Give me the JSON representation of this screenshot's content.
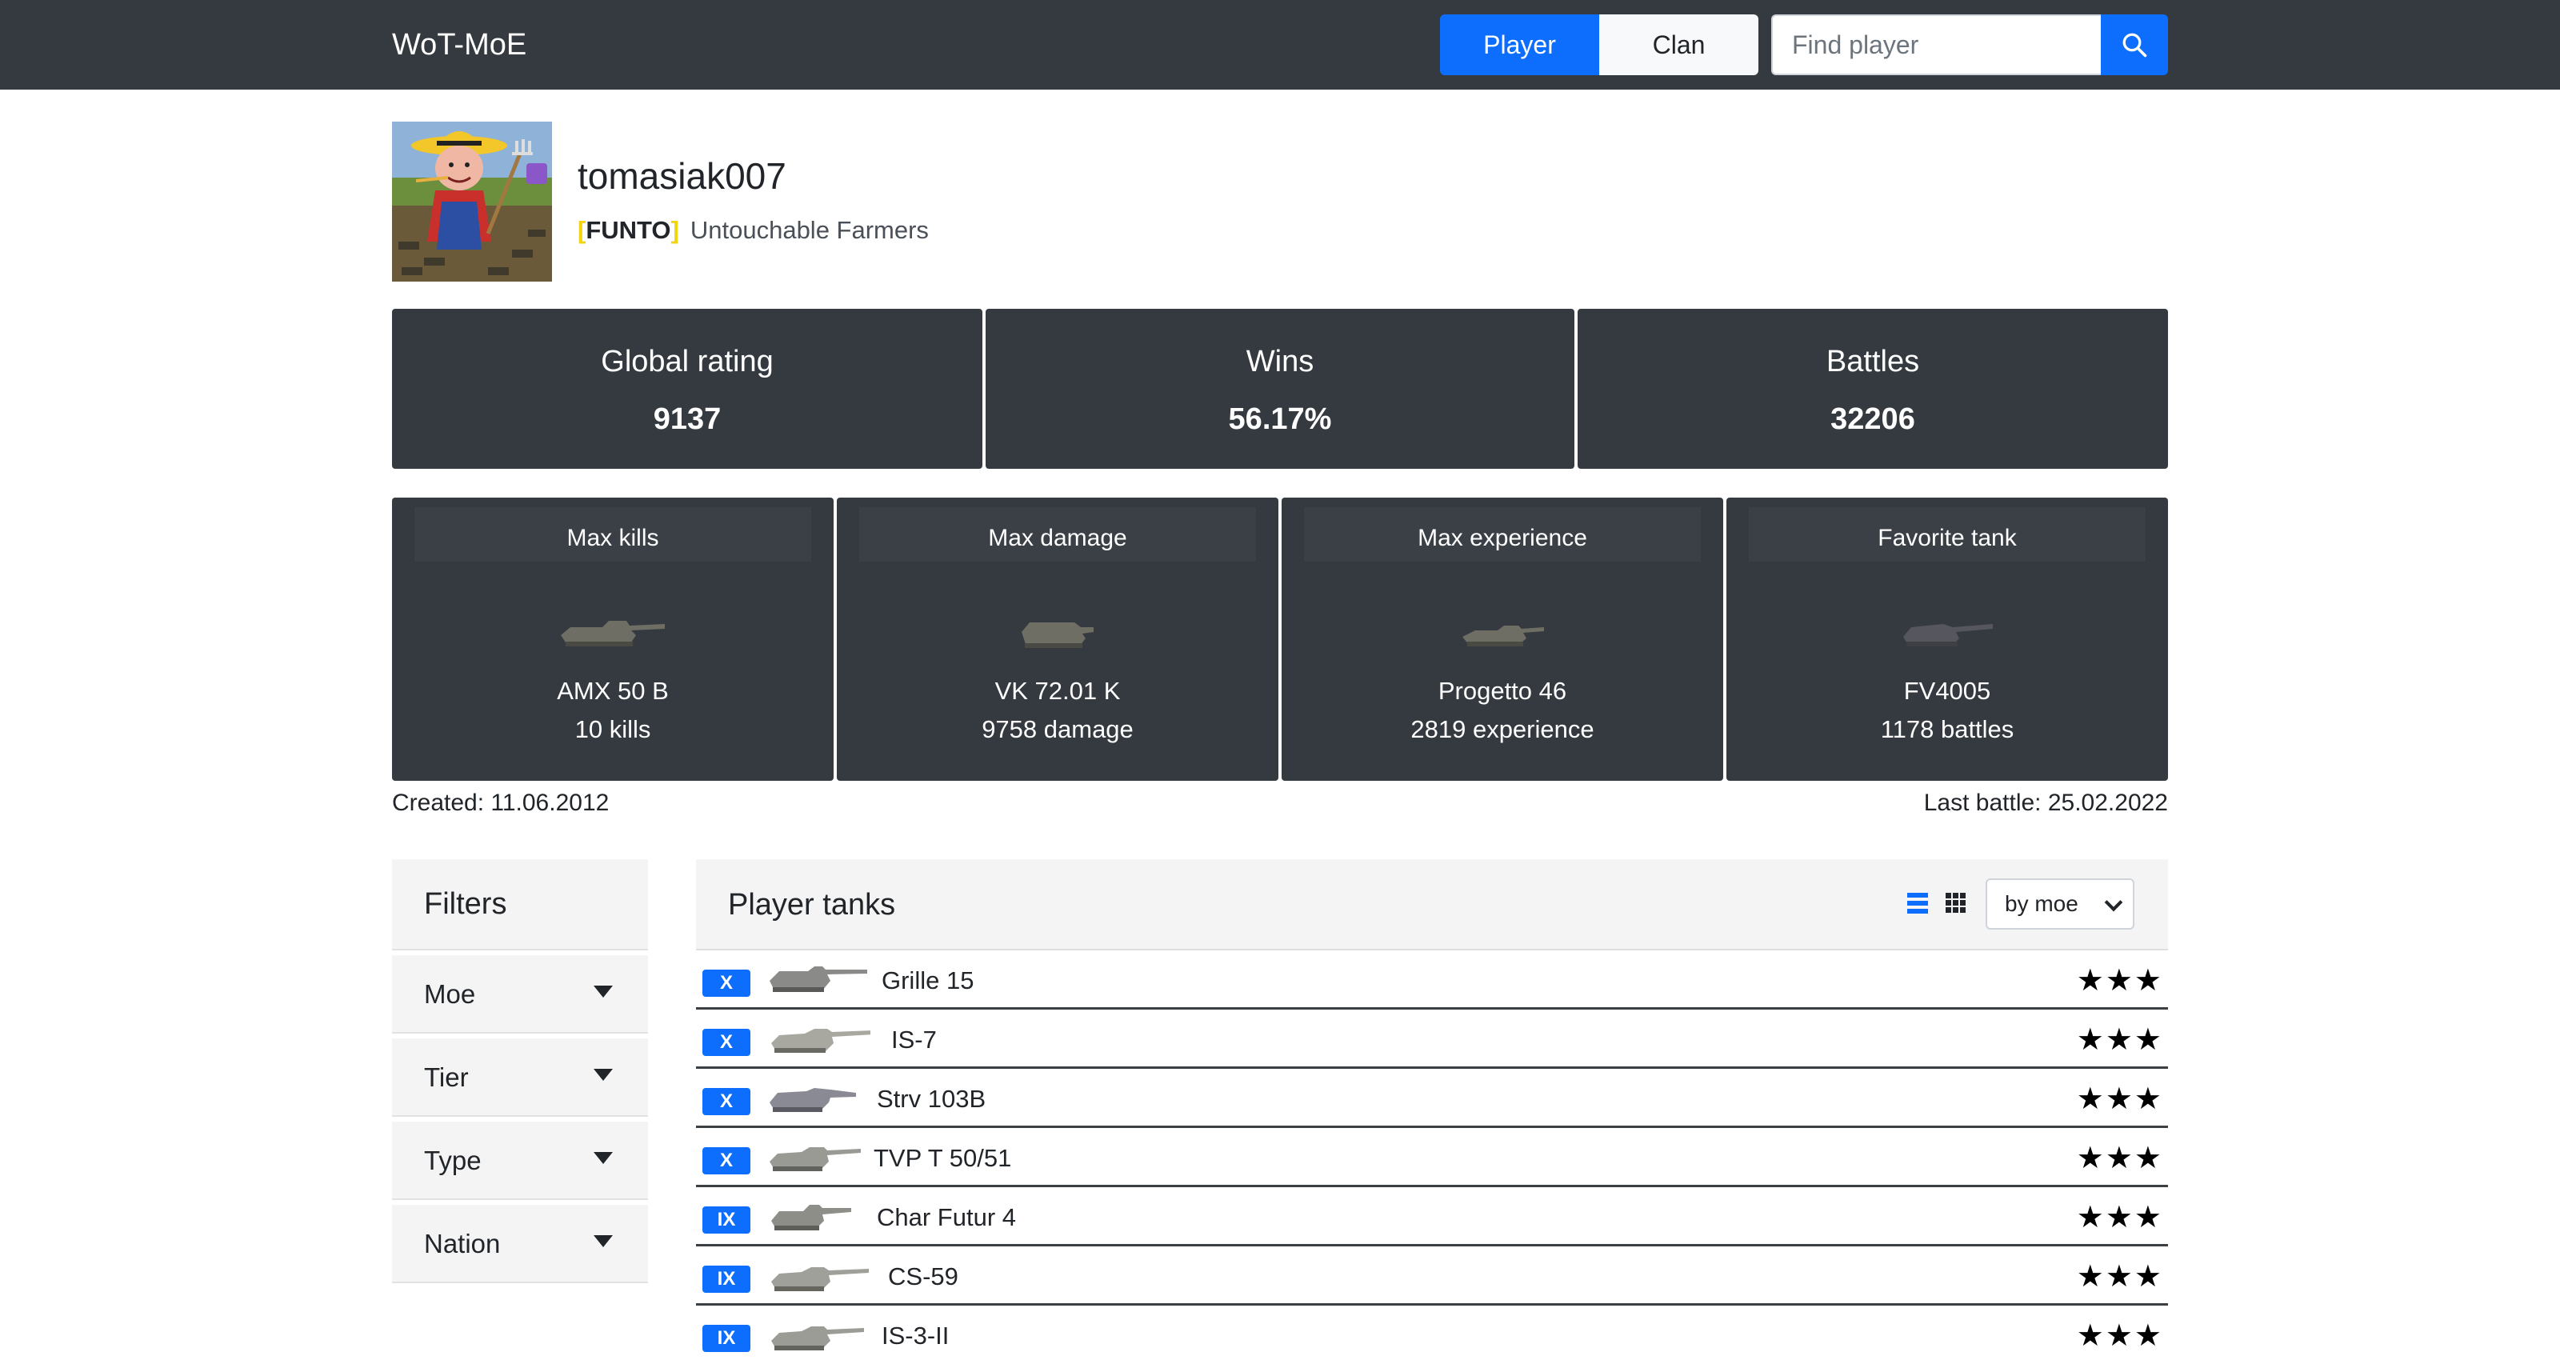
{
  "nav": {
    "brand": "WoT-MoE",
    "tab_player": "Player",
    "tab_clan": "Clan",
    "search_placeholder": "Find player",
    "search_icon": "search-icon"
  },
  "profile": {
    "username": "tomasiak007",
    "clan_tag": "FUNTO",
    "clan_name": "Untouchable Farmers"
  },
  "stats": [
    {
      "title": "Global rating",
      "value": "9137"
    },
    {
      "title": "Wins",
      "value": "56.17%"
    },
    {
      "title": "Battles",
      "value": "32206"
    }
  ],
  "records": [
    {
      "title": "Max kills",
      "tank": "AMX 50 B",
      "value": "10 kills"
    },
    {
      "title": "Max damage",
      "tank": "VK 72.01 K",
      "value": "9758 damage"
    },
    {
      "title": "Max experience",
      "tank": "Progetto 46",
      "value": "2819 experience"
    },
    {
      "title": "Favorite tank",
      "tank": "FV4005",
      "value": "1178 battles"
    }
  ],
  "dates": {
    "created": "Created: 11.06.2012",
    "last_battle": "Last battle: 25.02.2022"
  },
  "filters": {
    "title": "Filters",
    "items": [
      "Moe",
      "Tier",
      "Type",
      "Nation"
    ]
  },
  "tanks": {
    "title": "Player tanks",
    "sort_value": "by moe",
    "rows": [
      {
        "tier": "X",
        "name": "Grille 15",
        "stars": "★★★"
      },
      {
        "tier": "X",
        "name": "IS-7",
        "stars": "★★★"
      },
      {
        "tier": "X",
        "name": "Strv 103B",
        "stars": "★★★"
      },
      {
        "tier": "X",
        "name": "TVP T 50/51",
        "stars": "★★★"
      },
      {
        "tier": "IX",
        "name": "Char Futur 4",
        "stars": "★★★"
      },
      {
        "tier": "IX",
        "name": "CS-59",
        "stars": "★★★"
      },
      {
        "tier": "IX",
        "name": "IS-3-II",
        "stars": "★★★"
      }
    ]
  },
  "colors": {
    "navbar": "#343a40",
    "accent": "#0d6efd",
    "clan_bracket": "#f2d40f",
    "card": "#343a40"
  }
}
